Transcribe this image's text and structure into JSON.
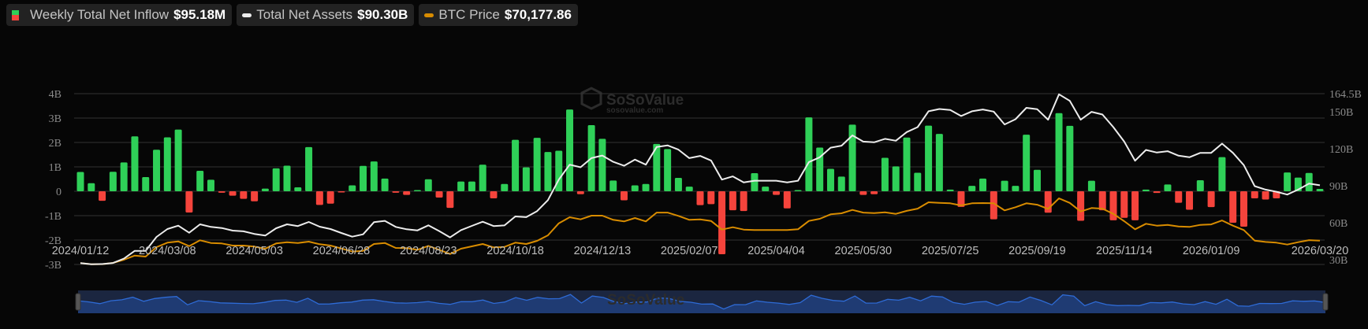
{
  "legend": [
    {
      "label": "Weekly Total Net Inflow",
      "value": "$95.18M",
      "icon": "green-red-bar-swatch"
    },
    {
      "label": "Total Net Assets",
      "value": "$90.30B",
      "icon": "white-line-swatch"
    },
    {
      "label": "BTC Price",
      "value": "$70,177.86",
      "icon": "orange-line-swatch"
    }
  ],
  "watermark": {
    "brand": "SoSoValue",
    "site": "sosovalue.com"
  },
  "colors": {
    "inflow_positive": "#2fd058",
    "inflow_negative": "#f5443c",
    "net_assets": "#ececec",
    "btc_price": "#d88c00",
    "grid": "#333333",
    "navigator_bg": "#1b2640",
    "navigator_fill": "#1f3b73",
    "navigator_line": "#2e6bd6"
  },
  "chart_data": {
    "type": "bar+line",
    "grid": true,
    "legend_position": "top-left",
    "x_tick_labels": [
      "2024/01/12",
      "2024/03/08",
      "2024/05/03",
      "2024/06/28",
      "2024/08/23",
      "2024/10/18",
      "2024/12/13",
      "2025/02/07",
      "2025/04/04",
      "2025/05/30",
      "2025/07/25",
      "2025/09/19",
      "2025/11/14",
      "2026/01/09",
      "2026/03/20"
    ],
    "left_axis": {
      "ticks": [
        "4B",
        "3B",
        "2B",
        "1B",
        "0",
        "-1B",
        "-2B",
        "-3B"
      ],
      "ylim": [
        -3,
        4
      ],
      "unit": "USD billions"
    },
    "right_axis": {
      "ticks": [
        "164.5B",
        "150B",
        "120B",
        "90B",
        "60B",
        "30B"
      ],
      "tick_values": [
        164.5,
        150,
        120,
        90,
        60,
        30
      ],
      "ylim": [
        26.2,
        164.5
      ],
      "unit": "USD billions"
    },
    "btc_axis": {
      "ylim": [
        41100,
        249400
      ],
      "visible": false
    },
    "series": [
      {
        "name": "Weekly Total Net Inflow",
        "type": "bar",
        "axis": "left",
        "unit": "USD billions",
        "values": [
          0.79,
          0.33,
          -0.39,
          0.8,
          1.18,
          2.25,
          0.58,
          1.7,
          2.21,
          2.53,
          -0.87,
          0.84,
          0.47,
          -0.06,
          -0.18,
          -0.31,
          -0.41,
          0.11,
          0.94,
          1.05,
          0.16,
          1.81,
          -0.56,
          -0.51,
          -0.03,
          0.24,
          1.04,
          1.22,
          0.52,
          -0.06,
          -0.15,
          0.04,
          0.49,
          -0.26,
          -0.68,
          0.4,
          0.4,
          1.09,
          -0.29,
          0.3,
          2.11,
          0.98,
          2.19,
          1.61,
          1.66,
          3.35,
          -0.12,
          2.71,
          2.15,
          0.44,
          -0.37,
          0.24,
          0.3,
          1.94,
          1.73,
          0.55,
          0.19,
          -0.57,
          -0.53,
          -2.58,
          -0.78,
          -0.81,
          0.74,
          0.19,
          -0.15,
          -0.7,
          0.02,
          3.03,
          1.79,
          0.92,
          0.6,
          2.73,
          -0.15,
          -0.12,
          1.37,
          1.02,
          2.2,
          0.76,
          2.69,
          2.35,
          0.07,
          -0.64,
          0.22,
          0.52,
          -1.15,
          0.43,
          0.22,
          2.32,
          0.88,
          -0.88,
          3.2,
          2.68,
          -1.21,
          0.43,
          -0.78,
          -1.19,
          -1.09,
          -1.19,
          0.07,
          -0.07,
          0.28,
          -0.47,
          -0.76,
          0.45,
          -0.65,
          1.4,
          -1.29,
          -1.45,
          -0.29,
          -0.34,
          -0.29,
          0.77,
          0.56,
          0.75,
          0.095
        ]
      },
      {
        "name": "Total Net Assets",
        "type": "line",
        "axis": "right",
        "unit": "USD billions",
        "values": [
          27.3,
          26.4,
          26.5,
          27.4,
          30.9,
          37.2,
          37.2,
          48.5,
          54.9,
          57.6,
          51.9,
          58.7,
          56.6,
          55.7,
          53.6,
          53.0,
          50.9,
          49.6,
          55.5,
          58.7,
          57.3,
          60.6,
          56.8,
          54.9,
          51.7,
          48.7,
          50.6,
          60.4,
          61.5,
          56.6,
          54.7,
          53.8,
          57.9,
          53.2,
          48.1,
          54.0,
          57.4,
          60.8,
          57.3,
          57.8,
          65.1,
          64.5,
          69.4,
          78.3,
          94.9,
          107.0,
          104.9,
          112.3,
          114.4,
          109.3,
          106.1,
          111.1,
          107.0,
          121.3,
          122.6,
          119.2,
          112.3,
          114.1,
          110.4,
          94.9,
          97.5,
          92.7,
          94.0,
          94.0,
          94.0,
          92.7,
          94.0,
          109.1,
          113.0,
          120.8,
          122.4,
          130.7,
          125.7,
          125.1,
          127.9,
          126.4,
          133.4,
          137.4,
          150.2,
          152.1,
          151.3,
          146.4,
          150.2,
          151.7,
          150.0,
          139.6,
          143.8,
          153.0,
          151.9,
          143.4,
          164.0,
          158.7,
          143.4,
          149.8,
          147.6,
          137.4,
          125.7,
          110.2,
          118.9,
          116.8,
          117.9,
          114.3,
          113.0,
          116.6,
          116.6,
          124.0,
          116.6,
          106.6,
          89.6,
          86.8,
          85.1,
          82.8,
          86.8,
          91.7,
          90.3
        ]
      },
      {
        "name": "BTC Price",
        "type": "line",
        "axis": "hidden",
        "unit": "USD",
        "values": [
          42700,
          41400,
          41500,
          43000,
          46900,
          51900,
          50700,
          62200,
          67700,
          69200,
          63500,
          70600,
          67300,
          66700,
          64100,
          64100,
          62900,
          60300,
          66700,
          68300,
          67300,
          68900,
          65800,
          64100,
          60600,
          56800,
          57700,
          66100,
          67300,
          61300,
          61000,
          59000,
          63800,
          59000,
          53900,
          60300,
          63200,
          66100,
          61900,
          62500,
          67700,
          66100,
          69900,
          76600,
          91300,
          98700,
          96100,
          100600,
          100600,
          95500,
          93600,
          97700,
          93600,
          104400,
          104400,
          100300,
          95500,
          96100,
          94200,
          83600,
          86500,
          83600,
          83000,
          83000,
          83000,
          83000,
          84000,
          94200,
          96800,
          102200,
          103500,
          107600,
          104400,
          103800,
          104700,
          102800,
          106500,
          109200,
          116900,
          116200,
          115700,
          113100,
          115700,
          116000,
          115700,
          107000,
          110900,
          115700,
          114000,
          108900,
          121700,
          116200,
          105700,
          109900,
          109200,
          102800,
          93900,
          84000,
          90700,
          88400,
          89400,
          87500,
          86900,
          89400,
          90000,
          94800,
          88400,
          83000,
          70200,
          68600,
          67700,
          65400,
          68300,
          70800,
          70177.86
        ]
      }
    ]
  }
}
